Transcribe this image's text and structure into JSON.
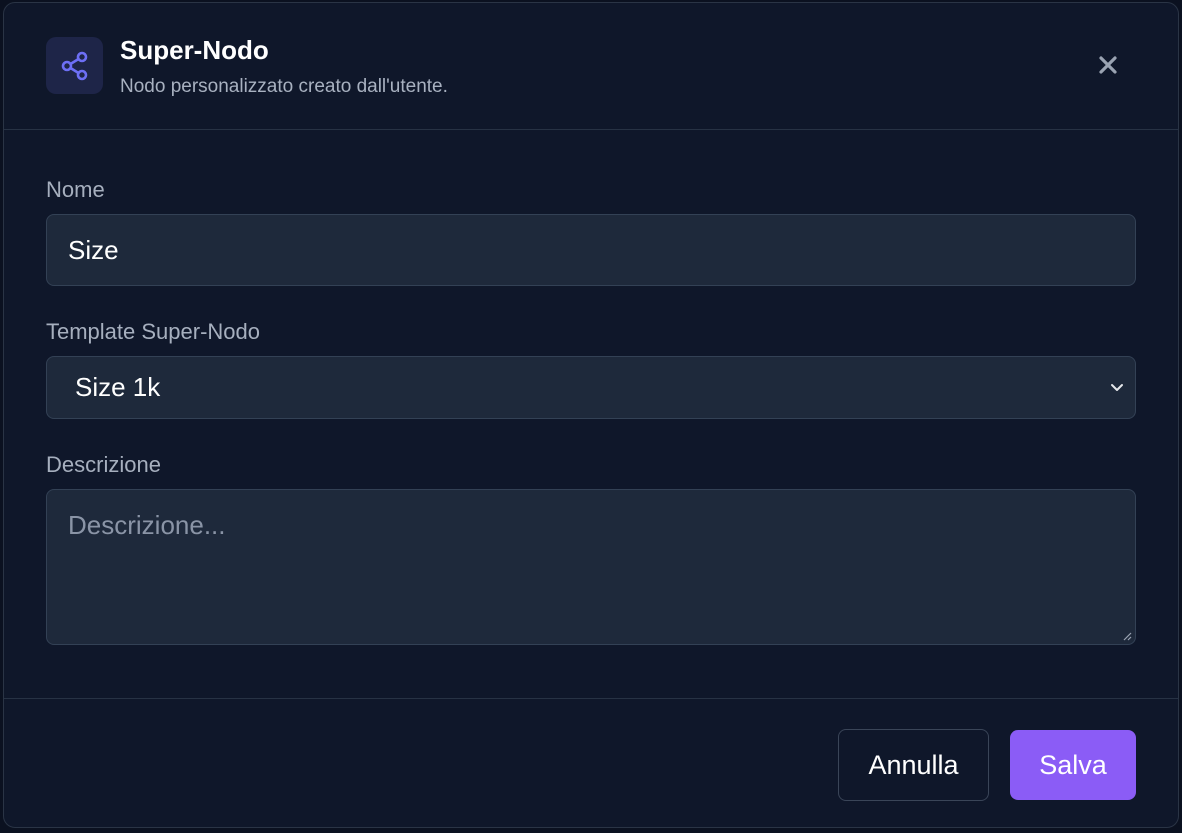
{
  "header": {
    "title": "Super-Nodo",
    "subtitle": "Nodo personalizzato creato dall'utente.",
    "icon": "share-nodes-icon",
    "accent_color": "#6366f1"
  },
  "form": {
    "name": {
      "label": "Nome",
      "value": "Size"
    },
    "template": {
      "label": "Template Super-Nodo",
      "selected": "Size 1k"
    },
    "description": {
      "label": "Descrizione",
      "value": "",
      "placeholder": "Descrizione..."
    }
  },
  "footer": {
    "cancel_label": "Annulla",
    "save_label": "Salva",
    "save_color": "#8b5cf6"
  }
}
